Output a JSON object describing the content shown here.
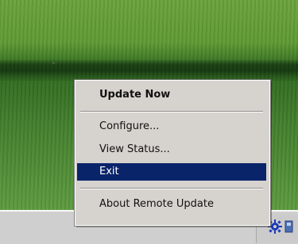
{
  "context_menu": {
    "items": [
      {
        "label": "Update Now",
        "bold": true,
        "selected": false
      },
      {
        "label": "Configure...",
        "bold": false,
        "selected": false
      },
      {
        "label": "View Status...",
        "bold": false,
        "selected": false
      },
      {
        "label": "Exit",
        "bold": false,
        "selected": true
      },
      {
        "label": "About Remote Update",
        "bold": false,
        "selected": false
      }
    ]
  },
  "system_tray": {
    "icons": [
      "gear-icon",
      "remote-update-icon"
    ]
  },
  "colors": {
    "menu_background": "#d6d3ce",
    "selection": "#0a246a",
    "selection_text": "#ffffff",
    "taskbar": "#cfcfcf",
    "tray_gear": "#1a39b8"
  }
}
